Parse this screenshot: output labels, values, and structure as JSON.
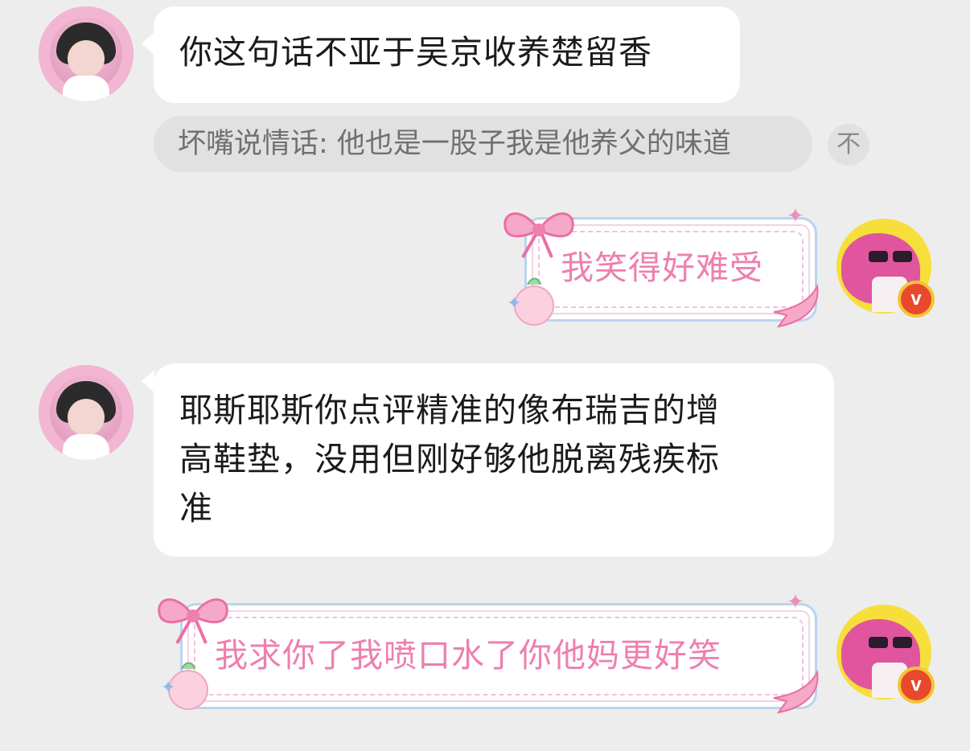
{
  "messages": [
    {
      "side": "left",
      "text": "你这句话不亚于吴京收养楚留香"
    },
    {
      "side": "left_quote",
      "text": "坏嘴说情话: 他也是一股子我是他养父的味道",
      "jump_icon": "不"
    },
    {
      "side": "right",
      "text": "我笑得好难受"
    },
    {
      "side": "left",
      "text_lines": [
        "耶斯耶斯你点评精准的像布瑞吉的增",
        "高鞋垫，没用但刚好够他脱离残疾标",
        "准"
      ]
    },
    {
      "side": "right",
      "text": "我求你了我喷口水了你他妈更好笑"
    }
  ],
  "badge": {
    "label": "v"
  },
  "colors": {
    "background": "#ededed",
    "bubble": "#ffffff",
    "cute_text": "#ee7fae",
    "quote_bg": "#e1e1e1"
  }
}
